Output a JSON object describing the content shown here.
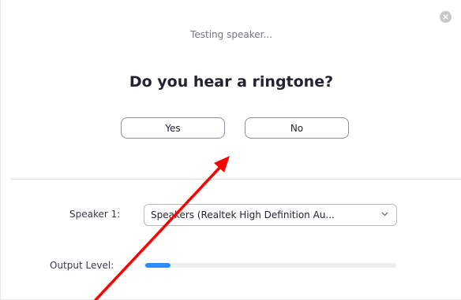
{
  "dialog": {
    "status_text": "Testing speaker...",
    "question": "Do you hear a ringtone?",
    "yes_label": "Yes",
    "no_label": "No",
    "close_icon": "close-icon"
  },
  "speaker": {
    "label": "Speaker 1:",
    "selected_value": "Speakers (Realtek High Definition Au...",
    "dropdown_icon": "chevron-down-icon"
  },
  "output": {
    "label": "Output Level:",
    "level_fraction": 0.1
  },
  "annotation": {
    "arrow_color": "#ff0000"
  },
  "colors": {
    "accent": "#2d8cff",
    "text_primary": "#232333"
  }
}
